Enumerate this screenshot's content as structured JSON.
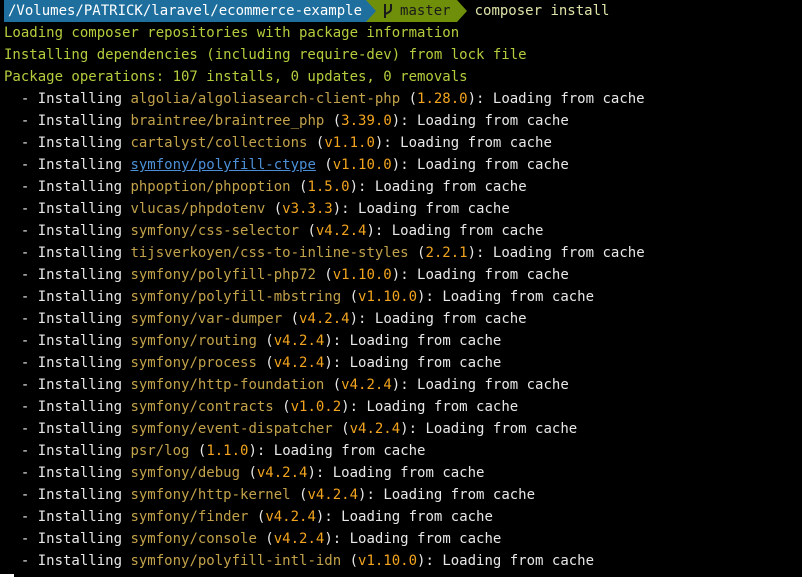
{
  "prompt": {
    "path": "/Volumes/PATRICK/laravel/ecommerce-example",
    "branch": "master",
    "command": "composer install"
  },
  "messages": [
    "Loading composer repositories with package information",
    "Installing dependencies (including require-dev) from lock file",
    "Package operations: 107 installs, 0 updates, 0 removals"
  ],
  "install_prefix": "  - Installing ",
  "install_suffix": ": Loading from cache",
  "packages": [
    {
      "name": "algolia/algoliasearch-client-php",
      "version": "1.28.0"
    },
    {
      "name": "braintree/braintree_php",
      "version": "3.39.0"
    },
    {
      "name": "cartalyst/collections",
      "version": "v1.1.0"
    },
    {
      "name": "symfony/polyfill-ctype",
      "version": "v1.10.0",
      "link": true
    },
    {
      "name": "phpoption/phpoption",
      "version": "1.5.0"
    },
    {
      "name": "vlucas/phpdotenv",
      "version": "v3.3.3"
    },
    {
      "name": "symfony/css-selector",
      "version": "v4.2.4"
    },
    {
      "name": "tijsverkoyen/css-to-inline-styles",
      "version": "2.2.1"
    },
    {
      "name": "symfony/polyfill-php72",
      "version": "v1.10.0"
    },
    {
      "name": "symfony/polyfill-mbstring",
      "version": "v1.10.0"
    },
    {
      "name": "symfony/var-dumper",
      "version": "v4.2.4"
    },
    {
      "name": "symfony/routing",
      "version": "v4.2.4"
    },
    {
      "name": "symfony/process",
      "version": "v4.2.4"
    },
    {
      "name": "symfony/http-foundation",
      "version": "v4.2.4"
    },
    {
      "name": "symfony/contracts",
      "version": "v1.0.2"
    },
    {
      "name": "symfony/event-dispatcher",
      "version": "v4.2.4"
    },
    {
      "name": "psr/log",
      "version": "1.1.0"
    },
    {
      "name": "symfony/debug",
      "version": "v4.2.4"
    },
    {
      "name": "symfony/http-kernel",
      "version": "v4.2.4"
    },
    {
      "name": "symfony/finder",
      "version": "v4.2.4"
    },
    {
      "name": "symfony/console",
      "version": "v4.2.4"
    },
    {
      "name": "symfony/polyfill-intl-idn",
      "version": "v1.10.0"
    }
  ],
  "colors": {
    "background": "#000000",
    "path_segment": "#1f6f9e",
    "branch_segment": "#6f8f0a",
    "message": "#b6cc3d",
    "package": "#c2a24a",
    "version": "#f2a41e",
    "link": "#4c8fd6"
  },
  "icons": {
    "branch": "git-branch-icon"
  }
}
